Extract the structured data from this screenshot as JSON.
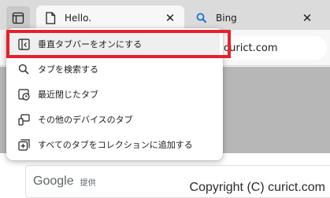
{
  "tabs": {
    "active": {
      "title": "Hello."
    },
    "inactive": {
      "title": "Bing"
    }
  },
  "address": {
    "text": "curict.com"
  },
  "page": {
    "search_brand": "Google",
    "search_provided": "提供"
  },
  "watermark": "Copyright (C) curict.com",
  "menu": {
    "items": [
      {
        "label": "垂直タブバーをオンにする",
        "icon": "vertical-tabs-icon"
      },
      {
        "label": "タブを検索する",
        "icon": "search-icon"
      },
      {
        "label": "最近閉じたタブ",
        "icon": "recently-closed-icon"
      },
      {
        "label": "その他のデバイスのタブ",
        "icon": "other-devices-icon"
      },
      {
        "label": "すべてのタブをコレクションに追加する",
        "icon": "add-to-collection-icon"
      }
    ]
  },
  "colors": {
    "highlight": "#e5212e",
    "bing_icon": "#1b6fd1"
  }
}
